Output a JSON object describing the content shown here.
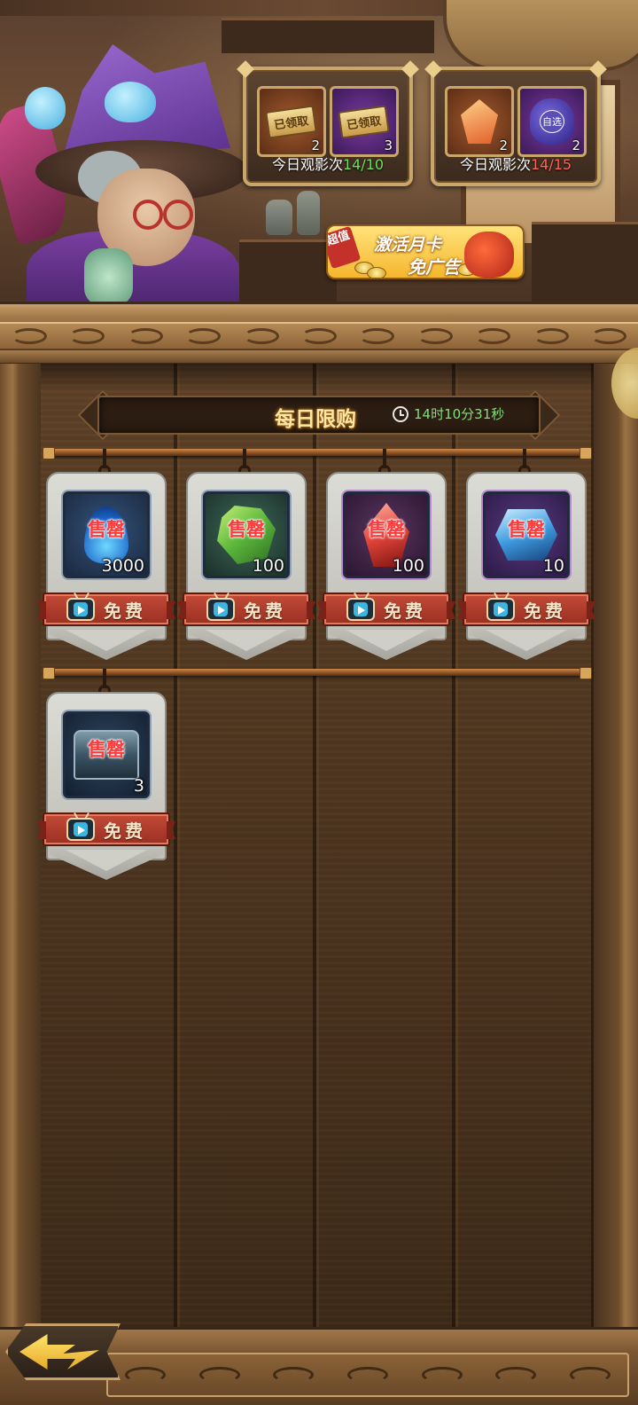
{
  "rewards": [
    {
      "items": [
        {
          "icon": "claim-ticket-icon",
          "ribbon": "已领取",
          "count": "2",
          "color": "orange"
        },
        {
          "icon": "claim-ticket-icon",
          "ribbon": "已领取",
          "count": "3",
          "color": "purple"
        }
      ],
      "label_prefix": "今日观影次",
      "progress": "14/10",
      "progress_color": "#6fe05b"
    },
    {
      "items": [
        {
          "icon": "orange-crystal-icon",
          "count": "2",
          "color": "orange"
        },
        {
          "icon": "purple-pouch-icon",
          "pouch_text": "自选",
          "count": "2",
          "color": "purple"
        }
      ],
      "label_prefix": "今日观影次",
      "progress": "14/15",
      "progress_color": "#ff6355"
    }
  ],
  "month_card": {
    "tag": "超值",
    "line1": "激活月卡",
    "line2": "免广告"
  },
  "shop": {
    "title": "每日限购",
    "timer": "14时10分31秒",
    "sold_out_label": "售罄",
    "free_label": "免费",
    "items": [
      {
        "icon": "blue-flame-icon",
        "qty": "3000",
        "slot": "blue"
      },
      {
        "icon": "green-gem-icon",
        "qty": "100",
        "slot": "green"
      },
      {
        "icon": "red-gem-icon",
        "qty": "100",
        "slot": "red"
      },
      {
        "icon": "blue-crystal-icon",
        "qty": "10",
        "slot": "violet"
      },
      {
        "icon": "treasure-chest-icon",
        "qty": "3",
        "slot": "steel"
      }
    ]
  }
}
